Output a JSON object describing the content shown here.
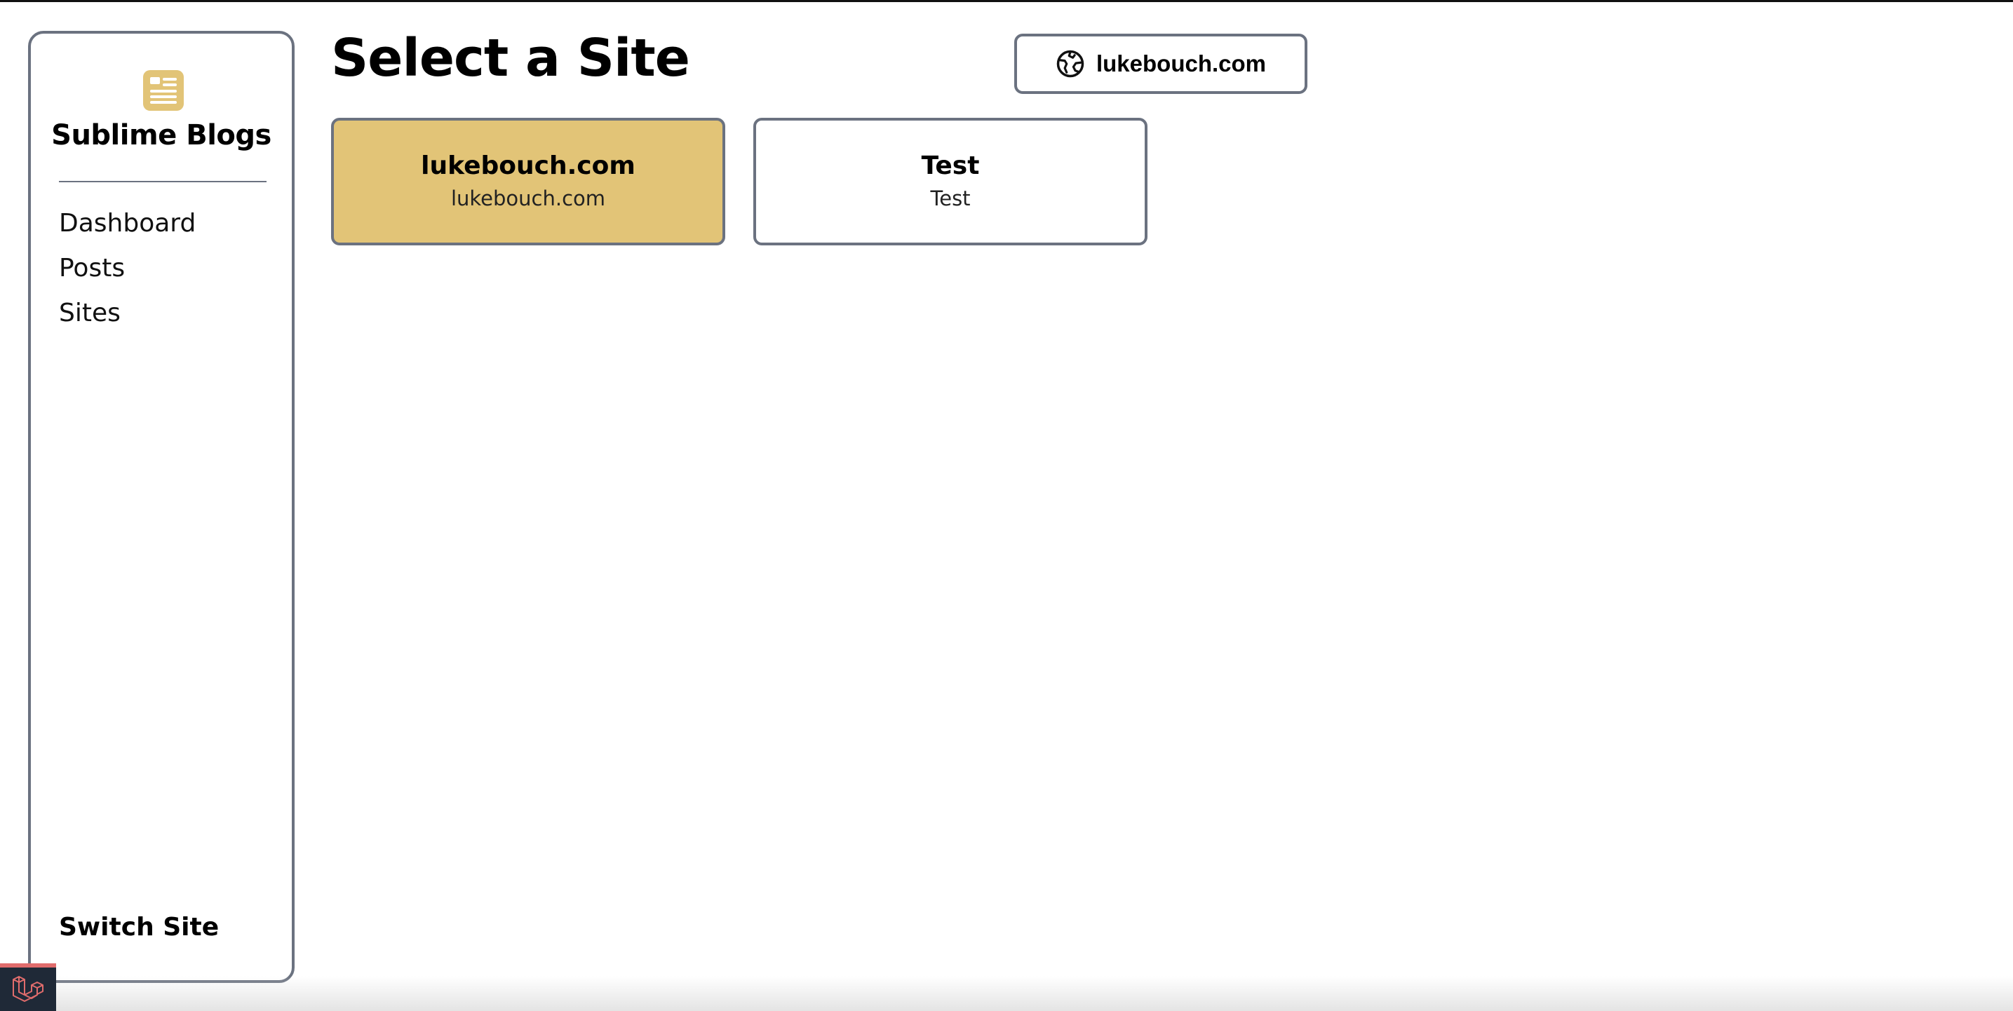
{
  "app": {
    "name": "Sublime Blogs",
    "accent_color": "#e2c477",
    "logo_icon": "newspaper-icon"
  },
  "sidebar": {
    "items": [
      {
        "label": "Dashboard"
      },
      {
        "label": "Posts"
      },
      {
        "label": "Sites"
      }
    ],
    "footer_label": "Switch Site"
  },
  "header": {
    "title": "Select a Site",
    "current_site_label": "lukebouch.com",
    "current_site_icon": "globe-icon"
  },
  "sites": [
    {
      "name": "lukebouch.com",
      "domain": "lukebouch.com",
      "selected": true
    },
    {
      "name": "Test",
      "domain": "Test",
      "selected": false
    }
  ],
  "debug_toolbar": {
    "icon": "laravel-logo-icon",
    "color": "#e06c6c"
  }
}
